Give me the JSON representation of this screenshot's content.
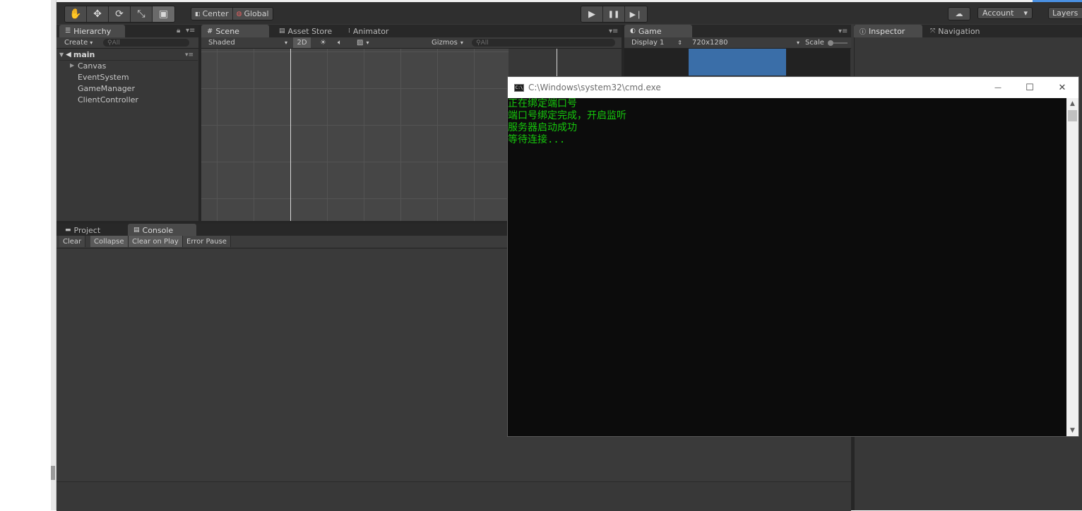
{
  "toolbar": {
    "tools": [
      {
        "name": "hand",
        "glyph": "✋"
      },
      {
        "name": "move",
        "glyph": "✥"
      },
      {
        "name": "rotate",
        "glyph": "⟳"
      },
      {
        "name": "scale",
        "glyph": "⤡"
      },
      {
        "name": "rect",
        "glyph": "▣"
      }
    ],
    "pivot_label": "Center",
    "space_label": "Global",
    "play_glyph": "▶",
    "pause_glyph": "❚❚",
    "step_glyph": "▶❘",
    "cloud_glyph": "☁",
    "account_label": "Account",
    "layers_label": "Layers",
    "dropdown_glyph": "▾"
  },
  "hierarchy": {
    "tab_label": "Hierarchy",
    "create_label": "Create",
    "search_placeholder": "All",
    "scene_name": "main",
    "items": [
      "Canvas",
      "EventSystem",
      "GameManager",
      "ClientController"
    ]
  },
  "scene": {
    "tab_scene": "Scene",
    "tab_asset_store": "Asset Store",
    "tab_animator": "Animator",
    "shading_mode": "Shaded",
    "mode_2d": "2D",
    "gizmos_label": "Gizmos",
    "search_placeholder": "All"
  },
  "game": {
    "tab_label": "Game",
    "display_label": "Display 1",
    "resolution_label": "720x1280",
    "scale_label": "Scale"
  },
  "inspector": {
    "tab_inspector": "Inspector",
    "tab_navigation": "Navigation"
  },
  "console": {
    "tab_project": "Project",
    "tab_console": "Console",
    "clear_label": "Clear",
    "collapse_label": "Collapse",
    "clear_on_play_label": "Clear on Play",
    "error_pause_label": "Error Pause"
  },
  "cmd": {
    "title": "C:\\Windows\\system32\\cmd.exe",
    "icon_text": "C:\\",
    "lines": [
      "正在绑定端口号",
      "端口号绑定完成，开启监听",
      "服务器启动成功",
      "等待连接..."
    ],
    "min_glyph": "—",
    "max_glyph": "☐",
    "close_glyph": "✕"
  },
  "colors": {
    "unity_bg": "#383838",
    "cmd_text": "#16c60c",
    "game_canvas_top": "#3a6ea8"
  }
}
